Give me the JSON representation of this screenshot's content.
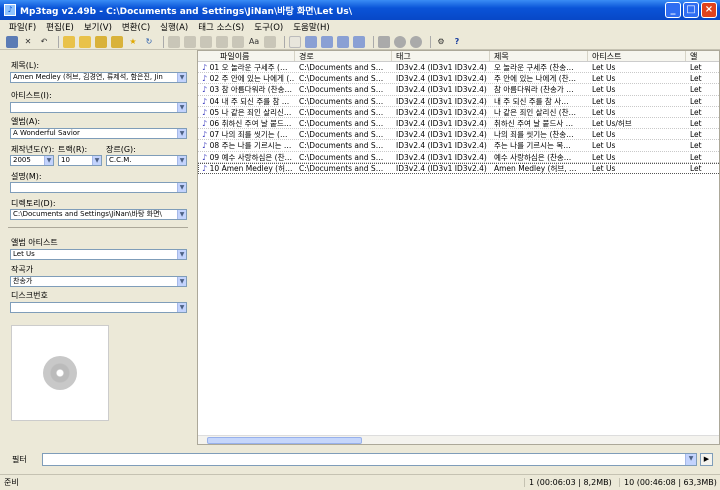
{
  "window": {
    "title": "Mp3tag v2.49b  -  C:\\Documents and Settings\\JiNan\\바탕 화면\\Let Us\\"
  },
  "menu": [
    "파일(F)",
    "편집(E)",
    "보기(V)",
    "변환(C)",
    "실행(A)",
    "태그 소스(S)",
    "도구(O)",
    "도움말(H)"
  ],
  "fields": {
    "title_label": "제목(L):",
    "title_value": "Amen Medley (허브, 김경연, 류제석, 함은진, Jin",
    "artist_label": "아티스트(I):",
    "artist_value": "",
    "album_label": "앨범(A):",
    "album_value": "A Wonderful Savior",
    "year_label": "제작년도(Y):",
    "year_value": "2005",
    "track_label": "트랙(R):",
    "track_value": "10",
    "genre_label": "장르(G):",
    "genre_value": "C.C.M.",
    "comment_label": "설명(M):",
    "comment_value": "",
    "dir_label": "디렉토리(D):",
    "dir_value": "C:\\Documents and Settings\\JiNan\\바탕 화면\\",
    "albumartist_label": "앨범 아티스트",
    "albumartist_value": "Let Us",
    "composer_label": "작곡가",
    "composer_value": "찬송가",
    "disc_label": "디스크번호",
    "disc_value": ""
  },
  "columns": [
    "파일이름",
    "경로",
    "태그",
    "제목",
    "아티스트",
    "앨"
  ],
  "rows": [
    {
      "file": "01 오 놀라운 구세주 (…",
      "path": "C:\\Documents and S…",
      "tag": "ID3v2.4 (ID3v1 ID3v2.4)",
      "title": "오 놀라운 구세주 (찬송…",
      "artist": "Let Us",
      "album": "Let"
    },
    {
      "file": "02 주 안에 있는 나에게 (…",
      "path": "C:\\Documents and S…",
      "tag": "ID3v2.4 (ID3v1 ID3v2.4)",
      "title": "주 안에 있는 나에게 (찬…",
      "artist": "Let Us",
      "album": "Let"
    },
    {
      "file": "03 참 아름다워라 (찬송…",
      "path": "C:\\Documents and S…",
      "tag": "ID3v2.4 (ID3v1 ID3v2.4)",
      "title": "참 아름다워라 (찬송가 …",
      "artist": "Let Us",
      "album": "Let"
    },
    {
      "file": "04 내 주 되신 주를 참 …",
      "path": "C:\\Documents and S…",
      "tag": "ID3v2.4 (ID3v1 ID3v2.4)",
      "title": "내 주 되신 주를 참 사…",
      "artist": "Let Us",
      "album": "Let"
    },
    {
      "file": "05 나 같은 죄인 살리신…",
      "path": "C:\\Documents and S…",
      "tag": "ID3v2.4 (ID3v1 ID3v2.4)",
      "title": "나 같은 죄인 살리신 (찬…",
      "artist": "Let Us",
      "album": "Let"
    },
    {
      "file": "06 취하신 주여 날 붙드…",
      "path": "C:\\Documents and S…",
      "tag": "ID3v2.4 (ID3v1 ID3v2.4)",
      "title": "취하신 주여 날 붙드사 …",
      "artist": "Let Us/허브",
      "album": "Let"
    },
    {
      "file": "07 나의 죄를 씻기는 (…",
      "path": "C:\\Documents and S…",
      "tag": "ID3v2.4 (ID3v1 ID3v2.4)",
      "title": "나의 죄를 씻기는 (찬송…",
      "artist": "Let Us",
      "album": "Let"
    },
    {
      "file": "08 주는 나를 기르시는 …",
      "path": "C:\\Documents and S…",
      "tag": "ID3v2.4 (ID3v1 ID3v2.4)",
      "title": "주는 나를 기르시는 목…",
      "artist": "Let Us",
      "album": "Let"
    },
    {
      "file": "09 예수 사랑하심은 (찬…",
      "path": "C:\\Documents and S…",
      "tag": "ID3v2.4 (ID3v1 ID3v2.4)",
      "title": "예수 사랑하심은 (찬송…",
      "artist": "Let Us",
      "album": "Let"
    },
    {
      "file": "10 Amen Medley (허…",
      "path": "C:\\Documents and S…",
      "tag": "ID3v2.4 (ID3v1 ID3v2.4)",
      "title": "Amen Medley (허브, …",
      "artist": "Let Us",
      "album": "Let"
    }
  ],
  "filter": {
    "label": "필터",
    "value": ""
  },
  "status": {
    "ready": "준비",
    "selected": "1 (00:06:03 | 8,2MB)",
    "total": "10 (00:46:08 | 63,3MB)"
  }
}
